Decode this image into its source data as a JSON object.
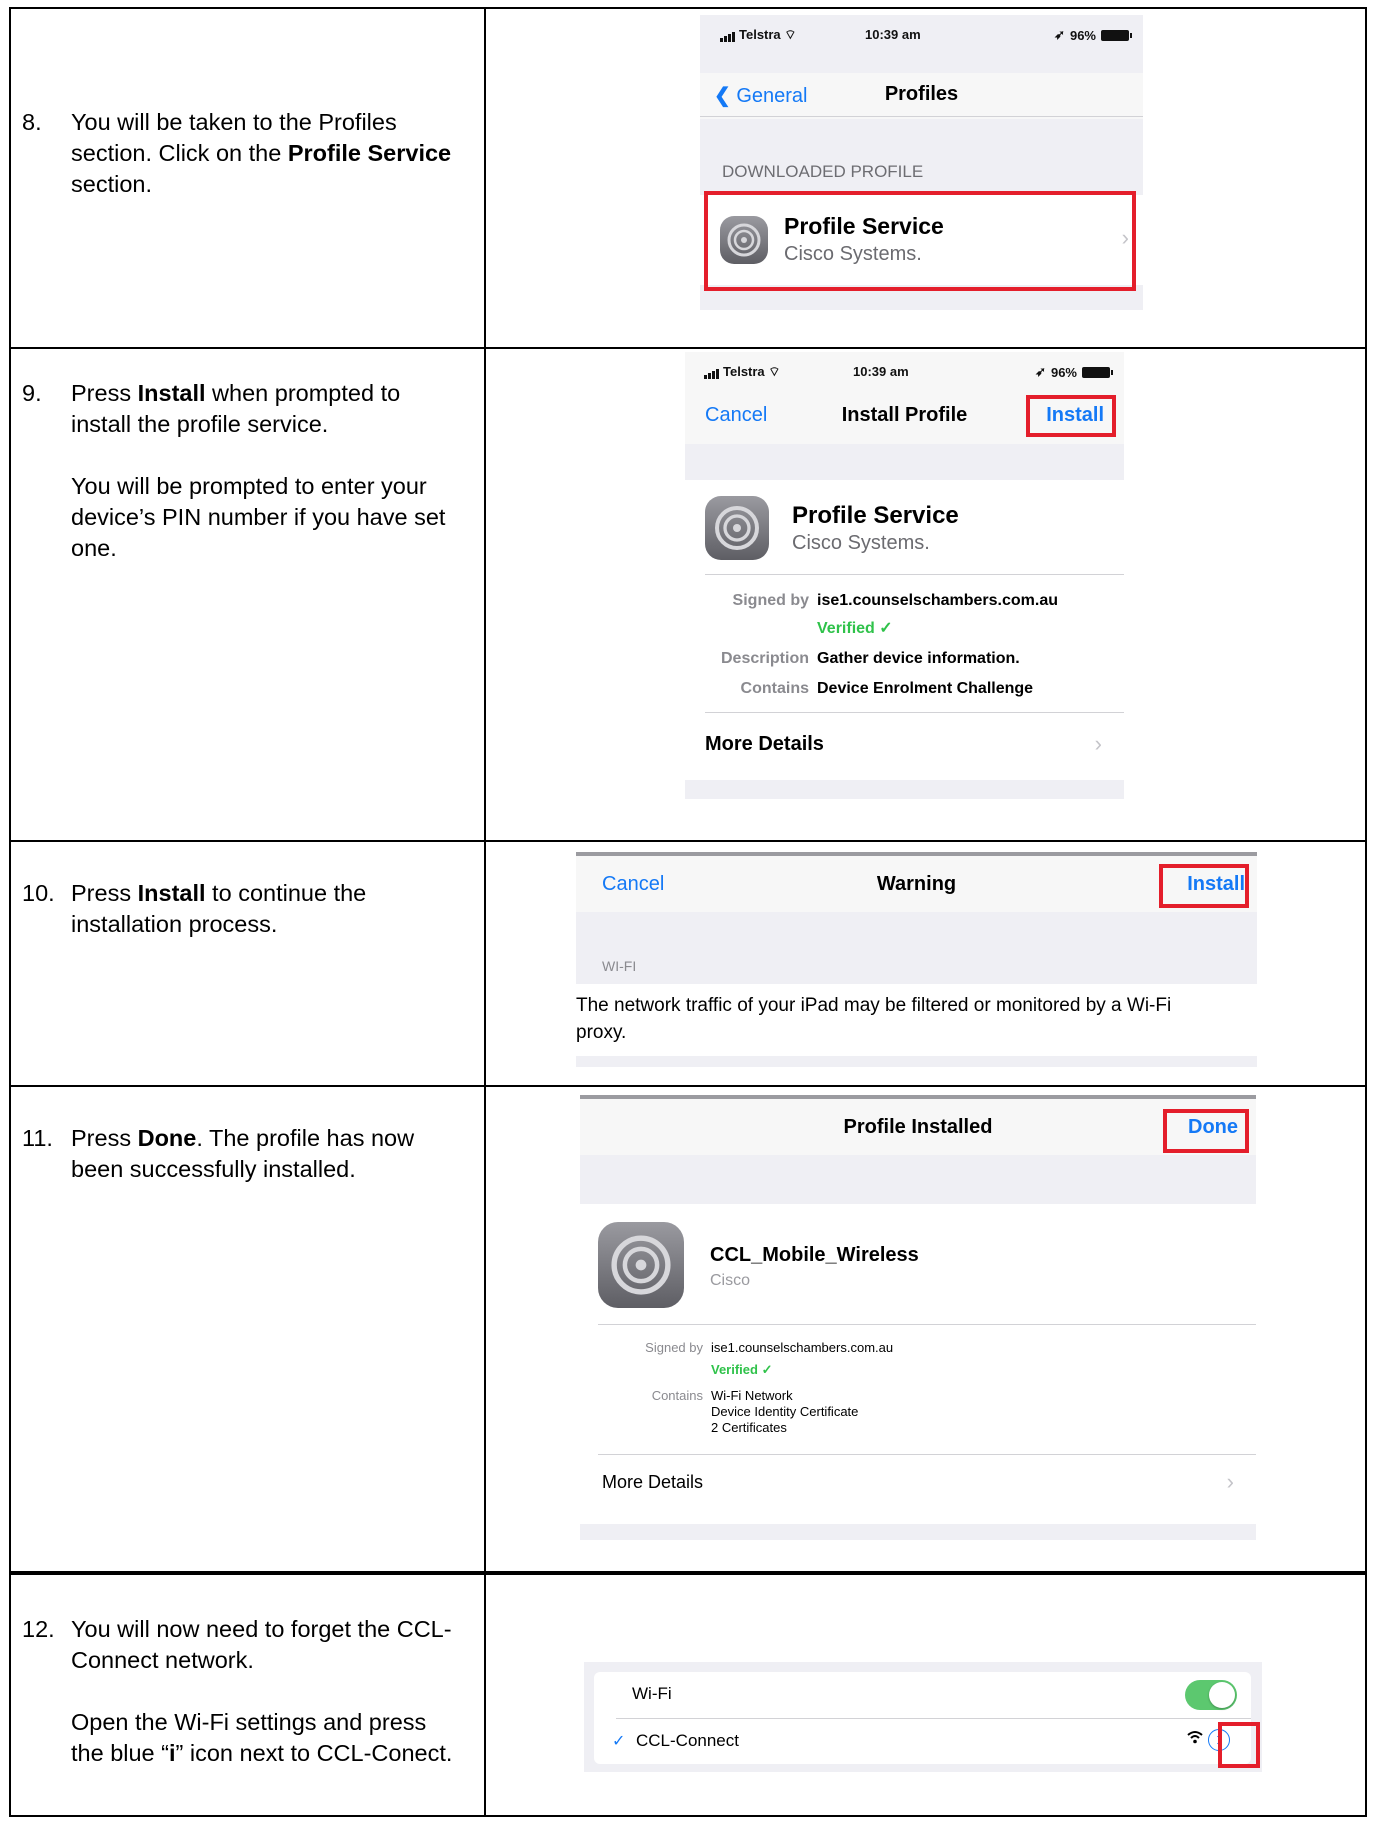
{
  "steps": [
    {
      "number": "8.",
      "lines": [
        [
          {
            "t": "You will be taken to the Profiles section. Click on the "
          },
          {
            "t": "Profile Service",
            "b": true
          },
          {
            "t": " section."
          }
        ]
      ]
    },
    {
      "number": "9.",
      "lines": [
        [
          {
            "t": "Press "
          },
          {
            "t": "Install",
            "b": true
          },
          {
            "t": " when prompted to install the profile service."
          }
        ],
        [
          {
            "t": "You will be prompted to enter your device’s PIN number if you have set one."
          }
        ]
      ]
    },
    {
      "number": "10.",
      "lines": [
        [
          {
            "t": "Press "
          },
          {
            "t": "Install",
            "b": true
          },
          {
            "t": " to continue the installation process."
          }
        ]
      ]
    },
    {
      "number": "11.",
      "lines": [
        [
          {
            "t": "Press "
          },
          {
            "t": "Done",
            "b": true
          },
          {
            "t": ". The profile has now been successfully installed."
          }
        ]
      ]
    },
    {
      "number": "12.",
      "lines": [
        [
          {
            "t": "You will now need to forget the CCL-Connect network."
          }
        ],
        [
          {
            "t": "Open the Wi-Fi settings and press the blue “"
          },
          {
            "t": "i",
            "b": true
          },
          {
            "t": "” icon next to CCL-Conect."
          }
        ]
      ]
    }
  ],
  "shot8": {
    "carrier": "Telstra",
    "time": "10:39 am",
    "battery": "96%",
    "back": "General",
    "title": "Profiles",
    "section": "DOWNLOADED PROFILE",
    "profile_name": "Profile Service",
    "profile_org": "Cisco Systems."
  },
  "shot9": {
    "carrier": "Telstra",
    "time": "10:39 am",
    "battery": "96%",
    "cancel": "Cancel",
    "title": "Install Profile",
    "install": "Install",
    "profile_name": "Profile Service",
    "profile_org": "Cisco Systems.",
    "signed_by_label": "Signed by",
    "signed_by": "ise1.counselschambers.com.au",
    "verified": "Verified ✓",
    "description_label": "Description",
    "description": "Gather device information.",
    "contains_label": "Contains",
    "contains": "Device Enrolment Challenge",
    "more": "More Details"
  },
  "shot10": {
    "cancel": "Cancel",
    "title": "Warning",
    "install": "Install",
    "section": "WI-FI",
    "message": "The network traffic of your iPad may be filtered or monitored by a Wi-Fi proxy."
  },
  "shot11": {
    "title": "Profile Installed",
    "done": "Done",
    "profile_name": "CCL_Mobile_Wireless",
    "profile_org": "Cisco",
    "signed_by_label": "Signed by",
    "signed_by": "ise1.counselschambers.com.au",
    "verified": "Verified ✓",
    "contains_label": "Contains",
    "contains": [
      "Wi-Fi Network",
      "Device Identity Certificate",
      "2 Certificates"
    ],
    "more": "More Details"
  },
  "shot12": {
    "wifi_label": "Wi-Fi",
    "wifi_on": true,
    "network": "CCL-Connect",
    "accent": "#1479f6",
    "toggle_color": "#5cc86f",
    "highlight": "#e41e2b"
  }
}
